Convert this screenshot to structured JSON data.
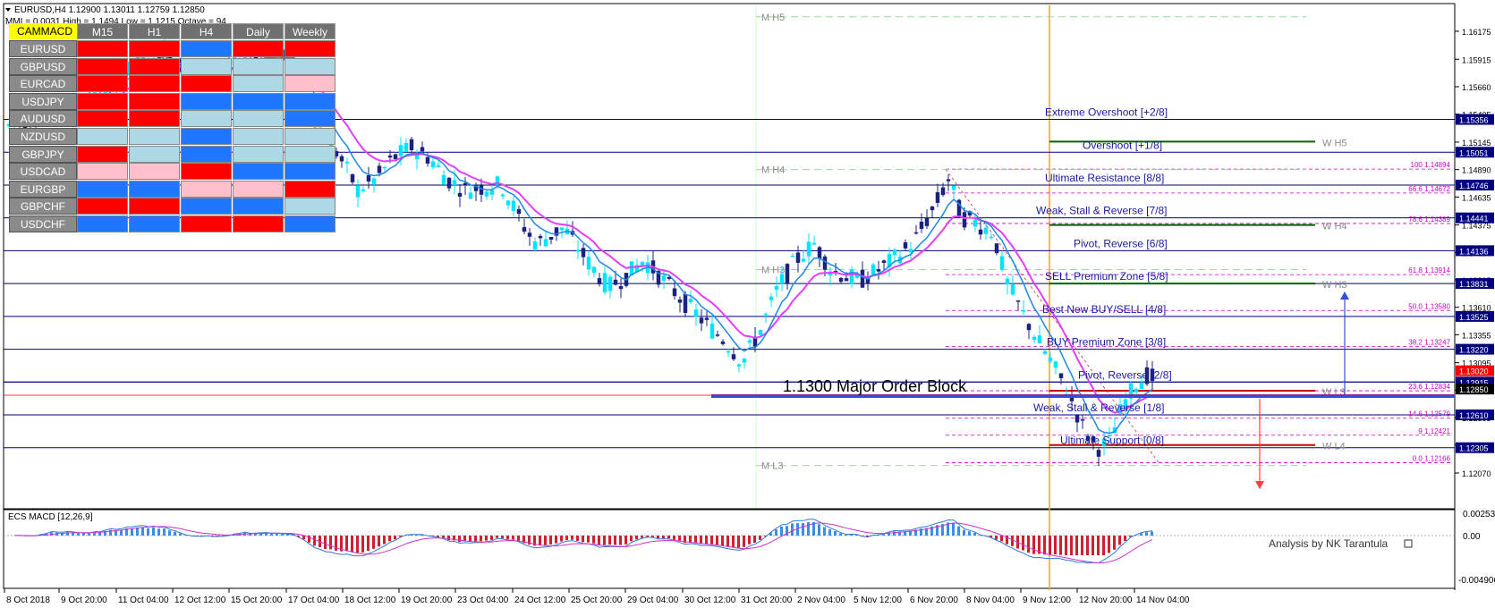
{
  "header": {
    "symbol_line": "EURUSD,H4  1.12900 1.13011 1.12759 1.12850",
    "mmi_line": "MMI = 0.0031   High = 1.1494   Low = 1.1215   Octave = 94"
  },
  "matrix": {
    "title": "CAMMACD",
    "timeframes": [
      "M15",
      "H1",
      "H4",
      "Daily",
      "Weekly"
    ],
    "rows": [
      {
        "pair": "EURUSD",
        "cells": [
          "red",
          "red",
          "blue",
          "red",
          "red"
        ]
      },
      {
        "pair": "GBPUSD",
        "cells": [
          "red",
          "red",
          "light",
          "light",
          "light"
        ]
      },
      {
        "pair": "EURCAD",
        "cells": [
          "red",
          "red",
          "red",
          "light",
          "pink"
        ]
      },
      {
        "pair": "USDJPY",
        "cells": [
          "red",
          "red",
          "blue",
          "blue",
          "blue"
        ]
      },
      {
        "pair": "AUDUSD",
        "cells": [
          "red",
          "red",
          "light",
          "light",
          "blue"
        ]
      },
      {
        "pair": "NZDUSD",
        "cells": [
          "light",
          "light",
          "blue",
          "light",
          "light"
        ]
      },
      {
        "pair": "GBPJPY",
        "cells": [
          "red",
          "light",
          "blue",
          "light",
          "light"
        ]
      },
      {
        "pair": "USDCAD",
        "cells": [
          "pink",
          "pink",
          "red",
          "blue",
          "blue"
        ]
      },
      {
        "pair": "EURGBP",
        "cells": [
          "blue",
          "blue",
          "pink",
          "pink",
          "red"
        ]
      },
      {
        "pair": "GBPCHF",
        "cells": [
          "red",
          "red",
          "blue",
          "blue",
          "light"
        ]
      },
      {
        "pair": "USDCHF",
        "cells": [
          "blue",
          "blue",
          "red",
          "red",
          "blue"
        ]
      }
    ],
    "colors": {
      "red": "#ff0000",
      "blue": "#1e78ff",
      "light": "#add8e6",
      "pink": "#ffc0cb"
    }
  },
  "price_axis": {
    "labels": [
      "1.16175",
      "1.15915",
      "1.15660",
      "1.15405",
      "1.15145",
      "1.14890",
      "1.14635",
      "1.14375",
      "1.14120",
      "1.13865",
      "1.13610",
      "1.13355",
      "1.13095",
      "1.12840",
      "1.12585",
      "1.12330",
      "1.12070"
    ],
    "tags": [
      {
        "text": "1.15356",
        "color": "#000080"
      },
      {
        "text": "1.15051",
        "color": "#000080"
      },
      {
        "text": "1.14746",
        "color": "#000080"
      },
      {
        "text": "1.14441",
        "color": "#000080"
      },
      {
        "text": "1.14136",
        "color": "#000080"
      },
      {
        "text": "1.13831",
        "color": "#000080"
      },
      {
        "text": "1.13525",
        "color": "#000080"
      },
      {
        "text": "1.13220",
        "color": "#000080"
      },
      {
        "text": "1.13020",
        "color": "#ff0000"
      },
      {
        "text": "1.12915",
        "color": "#000080"
      },
      {
        "text": "1.12850",
        "color": "#000000"
      },
      {
        "text": "1.12610",
        "color": "#000080"
      },
      {
        "text": "1.12305",
        "color": "#000080"
      }
    ]
  },
  "murrey": [
    {
      "label": "Extreme Overshoot [+2/8]",
      "price": 1.15356
    },
    {
      "label": "Overshoot [+1/8]",
      "price": 1.15051
    },
    {
      "label": "Ultimate Resistance [8/8]",
      "price": 1.14746
    },
    {
      "label": "Weak, Stall & Reverse [7/8]",
      "price": 1.14441
    },
    {
      "label": "Pivot, Reverse [6/8]",
      "price": 1.14136
    },
    {
      "label": "SELL Premium Zone [5/8]",
      "price": 1.13831
    },
    {
      "label": "Best New BUY/SELL [4/8]",
      "price": 1.13525
    },
    {
      "label": "BUY Premium Zone [3/8]",
      "price": 1.1322
    },
    {
      "label": "Pivot, Reverse [2/8]",
      "price": 1.12915
    },
    {
      "label": "Weak, Stall & Reverse [1/8]",
      "price": 1.1261
    },
    {
      "label": "Ultimate Support [0/8]",
      "price": 1.12305
    }
  ],
  "fib": [
    {
      "label": "100  1.14894"
    },
    {
      "label": "66.6  1.14672"
    },
    {
      "label": "78.6  1.14389"
    },
    {
      "label": "61.8  1.13914"
    },
    {
      "label": "50.0  1.13580"
    },
    {
      "label": "38.2  1.13247"
    },
    {
      "label": "23.6  1.12834"
    },
    {
      "label": "14.6  1.12579"
    },
    {
      "label": "9  1.12421"
    },
    {
      "label": "0.0  1.12166"
    }
  ],
  "pivot_tags": {
    "monthly": [
      "M H5",
      "M H4",
      "M H3",
      "M L3"
    ],
    "weekly": [
      "W H5",
      "W H4",
      "W H3",
      "W L3",
      "W L4"
    ]
  },
  "order_block_label": "1.1300 Major Order Block",
  "macd": {
    "title": "ECS MACD [12,26,9]",
    "axis": [
      "0.002538",
      "0.00",
      "-0.004906"
    ],
    "credit": "Analysis by NK Tarantula"
  },
  "time_axis": [
    "8 Oct 2018",
    "9 Oct 20:00",
    "11 Oct 04:00",
    "12 Oct 12:00",
    "15 Oct 20:00",
    "17 Oct 04:00",
    "18 Oct 12:00",
    "19 Oct 20:00",
    "23 Oct 04:00",
    "24 Oct 12:00",
    "25 Oct 20:00",
    "29 Oct 04:00",
    "30 Oct 12:00",
    "31 Oct 20:00",
    "2 Nov 04:00",
    "5 Nov 12:00",
    "6 Nov 20:00",
    "8 Nov 04:00",
    "9 Nov 12:00",
    "12 Nov 20:00",
    "14 Nov 04:00"
  ],
  "colors": {
    "up": "#00e5ff",
    "down": "#1a237e",
    "ma_fast": "#1e88e5",
    "ma_slow": "#e040fb",
    "grid_navy": "#000080",
    "murrey_text": "#1a1aa0",
    "fib": "#cc00cc",
    "order_block": "#3050e0",
    "vline": "#ffa500"
  }
}
